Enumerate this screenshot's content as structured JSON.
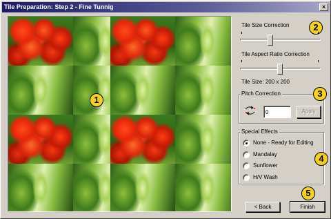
{
  "window": {
    "title": "Tile Preparation: Step 2 - Fine Tunnig",
    "close_glyph": "×"
  },
  "callouts": [
    "1",
    "2",
    "3",
    "4",
    "5"
  ],
  "tile_size": {
    "label": "Tile Size Correction",
    "value_fraction": 0.38
  },
  "aspect_ratio": {
    "label": "Tile Aspect Ratio Correction",
    "value_fraction": 0.5
  },
  "tile_size_readout": "Tile Size: 200 x 200",
  "pitch": {
    "group_label": "Pitch Correction",
    "icon": "rotate-arrows-icon",
    "value": "0",
    "apply_label": "Apply"
  },
  "special_effects": {
    "group_label": "Special Effects",
    "options": [
      {
        "label": "None - Ready for Editing",
        "selected": true
      },
      {
        "label": "Mandalay",
        "selected": false
      },
      {
        "label": "Sunflower",
        "selected": false
      },
      {
        "label": "H/V Wash",
        "selected": false
      }
    ]
  },
  "buttons": {
    "back_label": "< Back",
    "finish_label": "Finish"
  },
  "colors": {
    "callout": "#f7d21c",
    "titlebar_start": "#1a1a66",
    "face": "#d4d0c8"
  }
}
